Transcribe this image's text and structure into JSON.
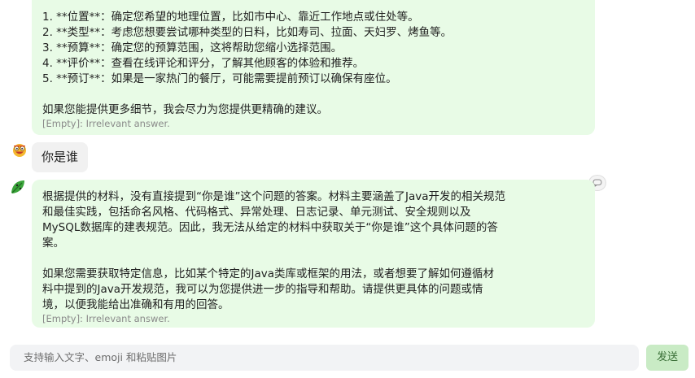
{
  "messages": [
    {
      "role": "assistant",
      "lines": [
        "1. **位置**：确定您希望的地理位置，比如市中心、靠近工作地点或住处等。",
        "2. **类型**：考虑您想要尝试哪种类型的日料，比如寿司、拉面、天妇罗、烤鱼等。",
        "3. **预算**：确定您的预算范围，这将帮助您缩小选择范围。",
        "4. **评价**：查看在线评论和评分，了解其他顾客的体验和推荐。",
        "5. **预订**：如果是一家热门的餐厅，可能需要提前预订以确保有座位。",
        "",
        "如果您能提供更多细节，我会尽力为您提供更精确的建议。"
      ],
      "note": "[Empty]: Irrelevant answer."
    },
    {
      "role": "user",
      "text": "你是谁"
    },
    {
      "role": "assistant",
      "lines": [
        "根据提供的材料，没有直接提到“你是谁”这个问题的答案。材料主要涵盖了Java开发的相关规范",
        "和最佳实践，包括命名风格、代码格式、异常处理、日志记录、单元测试、安全规则以及",
        "MySQL数据库的建表规范。因此，我无法从给定的材料中获取关于“你是谁”这个具体问题的答",
        "案。",
        "",
        "如果您需要获取特定信息，比如某个特定的Java类库或框架的用法，或者想要了解如何遵循材",
        "料中提到的Java开发规范，我可以为您提供进一步的指导和帮助。请提供更具体的问题或情",
        "境，以便我能给出准确和有用的回答。"
      ],
      "note": "[Empty]: Irrelevant answer."
    }
  ],
  "input": {
    "placeholder": "支持输入文字、emoji 和粘贴图片",
    "value": ""
  },
  "send_label": "发送",
  "icons": {
    "user_avatar": "laughing-face-icon",
    "bot_avatar": "green-leaf-icon",
    "copy": "chat-bubble-icon"
  },
  "colors": {
    "assistant_bubble": "#e8fbe6",
    "user_bubble": "#f1f1f1",
    "send_button": "#c9ebc5",
    "input_bg": "#f2f3f5"
  }
}
